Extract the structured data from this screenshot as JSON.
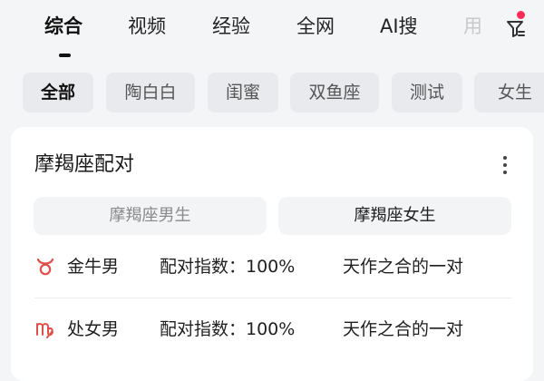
{
  "tabs": [
    {
      "label": "综合",
      "active": true
    },
    {
      "label": "视频"
    },
    {
      "label": "经验"
    },
    {
      "label": "全网"
    },
    {
      "label": "AI搜"
    },
    {
      "label": "用"
    }
  ],
  "filter": {
    "icon": "filter-icon",
    "badge_color": "#ff2d55"
  },
  "chips": [
    {
      "label": "全部",
      "active": true
    },
    {
      "label": "陶白白"
    },
    {
      "label": "闺蜜"
    },
    {
      "label": "双鱼座"
    },
    {
      "label": "测试"
    },
    {
      "label": "女生"
    }
  ],
  "card": {
    "title": "摩羯座配对",
    "more_icon": "more-vertical-icon",
    "segments": [
      {
        "label": "摩羯座男生",
        "selected": false
      },
      {
        "label": "摩羯座女生",
        "selected": true
      }
    ],
    "rows": [
      {
        "icon": "taurus-icon",
        "sign": "金牛男",
        "score": "配对指数：100%",
        "desc": "天作之合的一对"
      },
      {
        "icon": "virgo-icon",
        "sign": "处女男",
        "score": "配对指数：100%",
        "desc": "天作之合的一对"
      }
    ],
    "accent_color": "#e0504a"
  }
}
